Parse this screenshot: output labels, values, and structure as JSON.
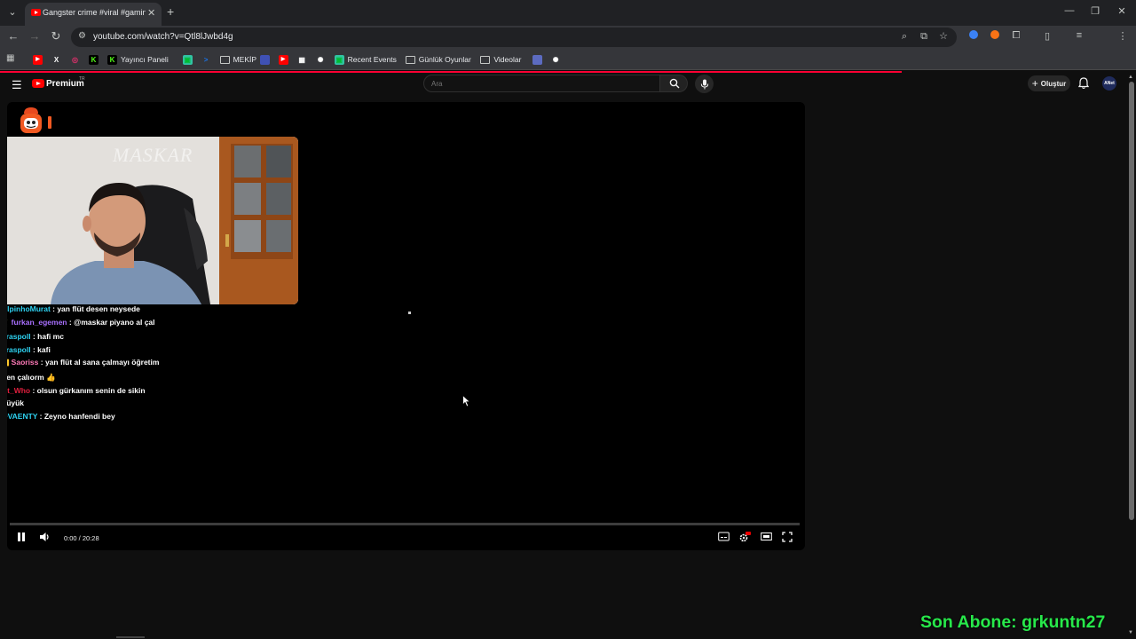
{
  "browser": {
    "tab_title": "Gangster crime #viral #gaming",
    "url": "youtube.com/watch?v=Qtl8lJwbd4g",
    "bookmarks": [
      {
        "label": "",
        "icon": "youtube-icon",
        "color": "#ff0000"
      },
      {
        "label": "",
        "icon": "x-icon",
        "color": "#000000"
      },
      {
        "label": "",
        "icon": "instagram-icon",
        "color": "#e1306c"
      },
      {
        "label": "",
        "icon": "kick-icon",
        "color": "#53fc18"
      },
      {
        "label": "Yayıncı Paneli",
        "icon": "kick-icon",
        "color": "#53fc18"
      },
      {
        "label": "",
        "icon": "streamlabs-icon",
        "color": "#31c3a2"
      },
      {
        "label": "",
        "icon": "prompt-icon",
        "color": "#1a73e8"
      },
      {
        "label": "MEKİP",
        "icon": "folder-icon",
        "color": "#c4c7c5"
      },
      {
        "label": "",
        "icon": "app-icon",
        "color": "#3f51b5"
      },
      {
        "label": "",
        "icon": "youtube-icon",
        "color": "#ff0000"
      },
      {
        "label": "",
        "icon": "image-icon",
        "color": "#e8eaed"
      },
      {
        "label": "",
        "icon": "openai-icon",
        "color": "#e8eaed"
      },
      {
        "label": "Recent Events",
        "icon": "streamlabs-icon",
        "color": "#31c3a2"
      },
      {
        "label": "Günlük Oyunlar",
        "icon": "folder-icon",
        "color": "#c4c7c5"
      },
      {
        "label": "Videolar",
        "icon": "folder-icon",
        "color": "#c4c7c5"
      },
      {
        "label": "",
        "icon": "app-icon",
        "color": "#5c6bc0"
      },
      {
        "label": "",
        "icon": "openai-icon",
        "color": "#e8eaed"
      }
    ]
  },
  "youtube": {
    "logo_text": "Premium",
    "region": "TR",
    "search_placeholder": "Ara",
    "create_label": "Oluştur",
    "avatar_text": "ANet"
  },
  "player": {
    "watermark": "MASKAR",
    "time": "0:00 / 20:28",
    "progress": 0,
    "chat": [
      {
        "prefix": "",
        "user": "AlpinhoMurat",
        "color": "#2ed3f2",
        "message": " : yan flüt desen neysede"
      },
      {
        "prefix": "🕺 ",
        "user": "furkan_egemen",
        "color": "#a970ff",
        "message": " : @maskar piyano al çal"
      },
      {
        "prefix": "",
        "user": "araspoll",
        "color": "#2ed3f2",
        "message": " : hafi mc"
      },
      {
        "prefix": "",
        "user": "araspoll",
        "color": "#2ed3f2",
        "message": " : kafi"
      },
      {
        "prefix": "🟨 ",
        "user": "Saoriss",
        "color": "#ff7ab8",
        "message": " : yan flüt al sana çalmayı öğretim\nben çalıorm 👍"
      },
      {
        "prefix": "",
        "user": "Dt_Who",
        "color": "#e01f3d",
        "message": " : olsun gürkanım senin de sikin\nbüyük"
      },
      {
        "prefix": "",
        "user": "QVAENTY",
        "color": "#2ed3f2",
        "message": " : Zeyno hanfendi bey"
      }
    ]
  },
  "overlay": {
    "sub_alert": "Son Abone: grkuntn27",
    "sub_alert_color": "#27e84a"
  }
}
